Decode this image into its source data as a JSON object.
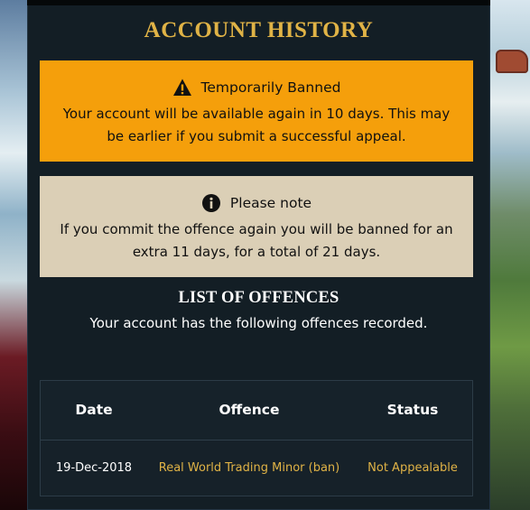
{
  "page": {
    "title": "ACCOUNT HISTORY"
  },
  "ban_notice": {
    "icon": "warning-triangle-icon",
    "heading": "Temporarily Banned",
    "body": "Your account will be available again in 10 days. This may be earlier if you submit a successful appeal.",
    "color": "#f59f0b"
  },
  "note": {
    "icon": "info-circle-icon",
    "heading": "Please note",
    "body": "If you commit the offence again you will be banned for an extra 11 days, for a total of 21 days.",
    "color": "#dbcfb6"
  },
  "offences": {
    "title": "LIST OF OFFENCES",
    "subtitle": "Your account has the following offences recorded.",
    "columns": [
      "Date",
      "Offence",
      "Status"
    ],
    "rows": [
      {
        "date": "19-Dec-2018",
        "offence": "Real World Trading Minor (ban)",
        "status": "Not Appealable"
      }
    ]
  },
  "colors": {
    "accent_gold": "#e0b346",
    "panel_bg": "#131e25"
  }
}
